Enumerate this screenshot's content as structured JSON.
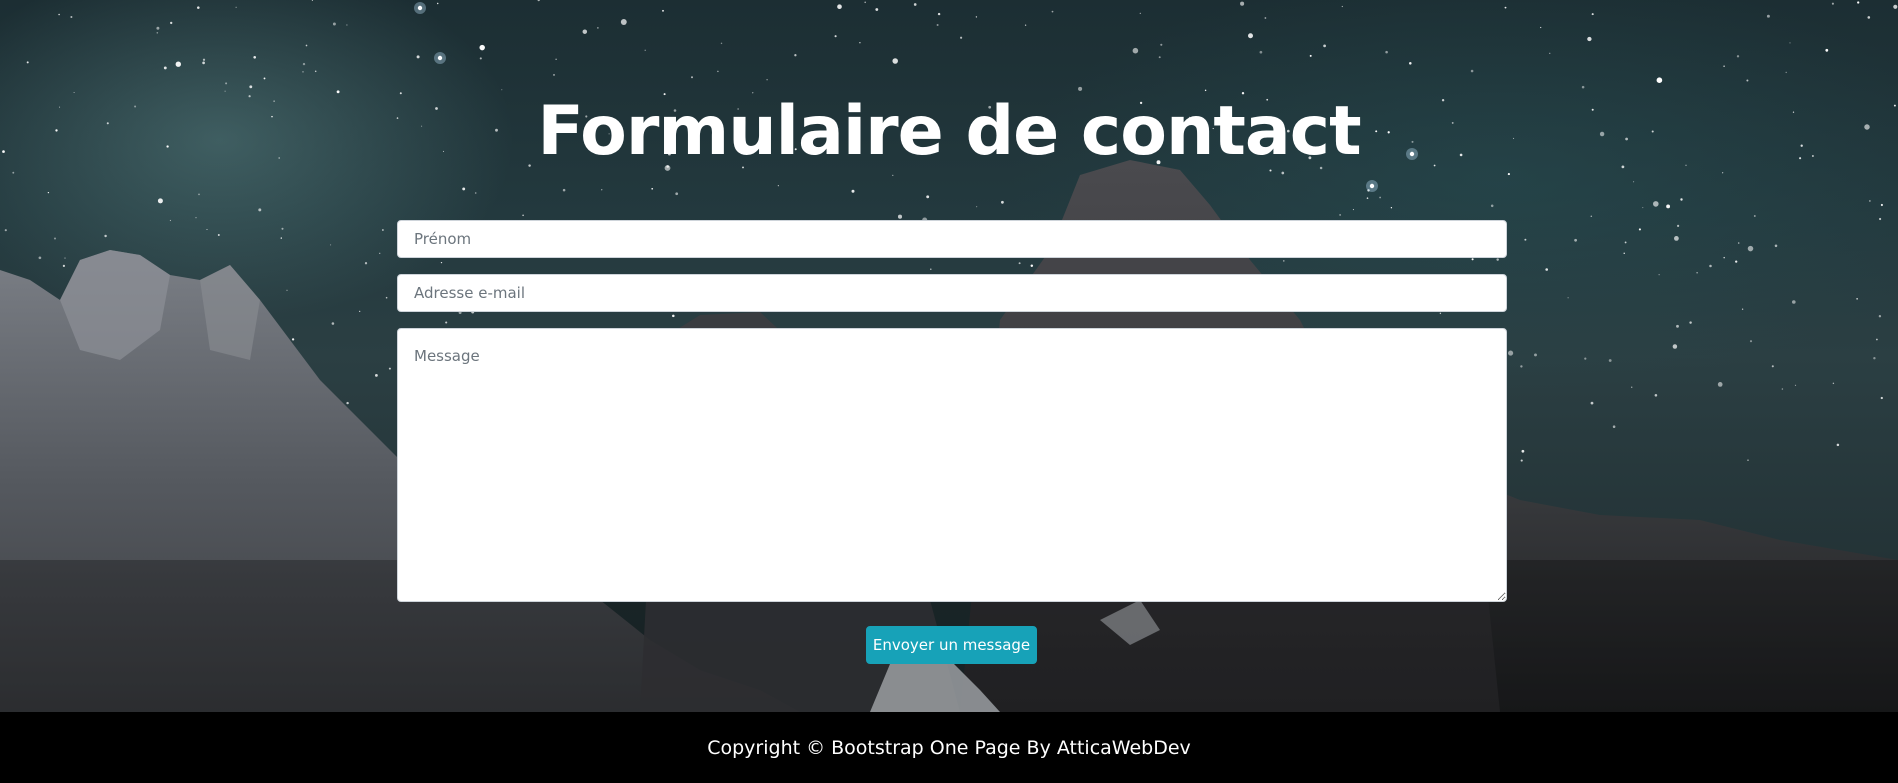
{
  "contact": {
    "title": "Formulaire de contact",
    "first_name_placeholder": "Prénom",
    "email_placeholder": "Adresse e-mail",
    "message_placeholder": "Message",
    "submit_label": "Envoyer un message"
  },
  "footer": {
    "text": "Copyright © Bootstrap One Page By AtticaWebDev"
  },
  "colors": {
    "accent": "#17a2b8",
    "footer_bg": "#000000",
    "title_text": "#ffffff"
  }
}
